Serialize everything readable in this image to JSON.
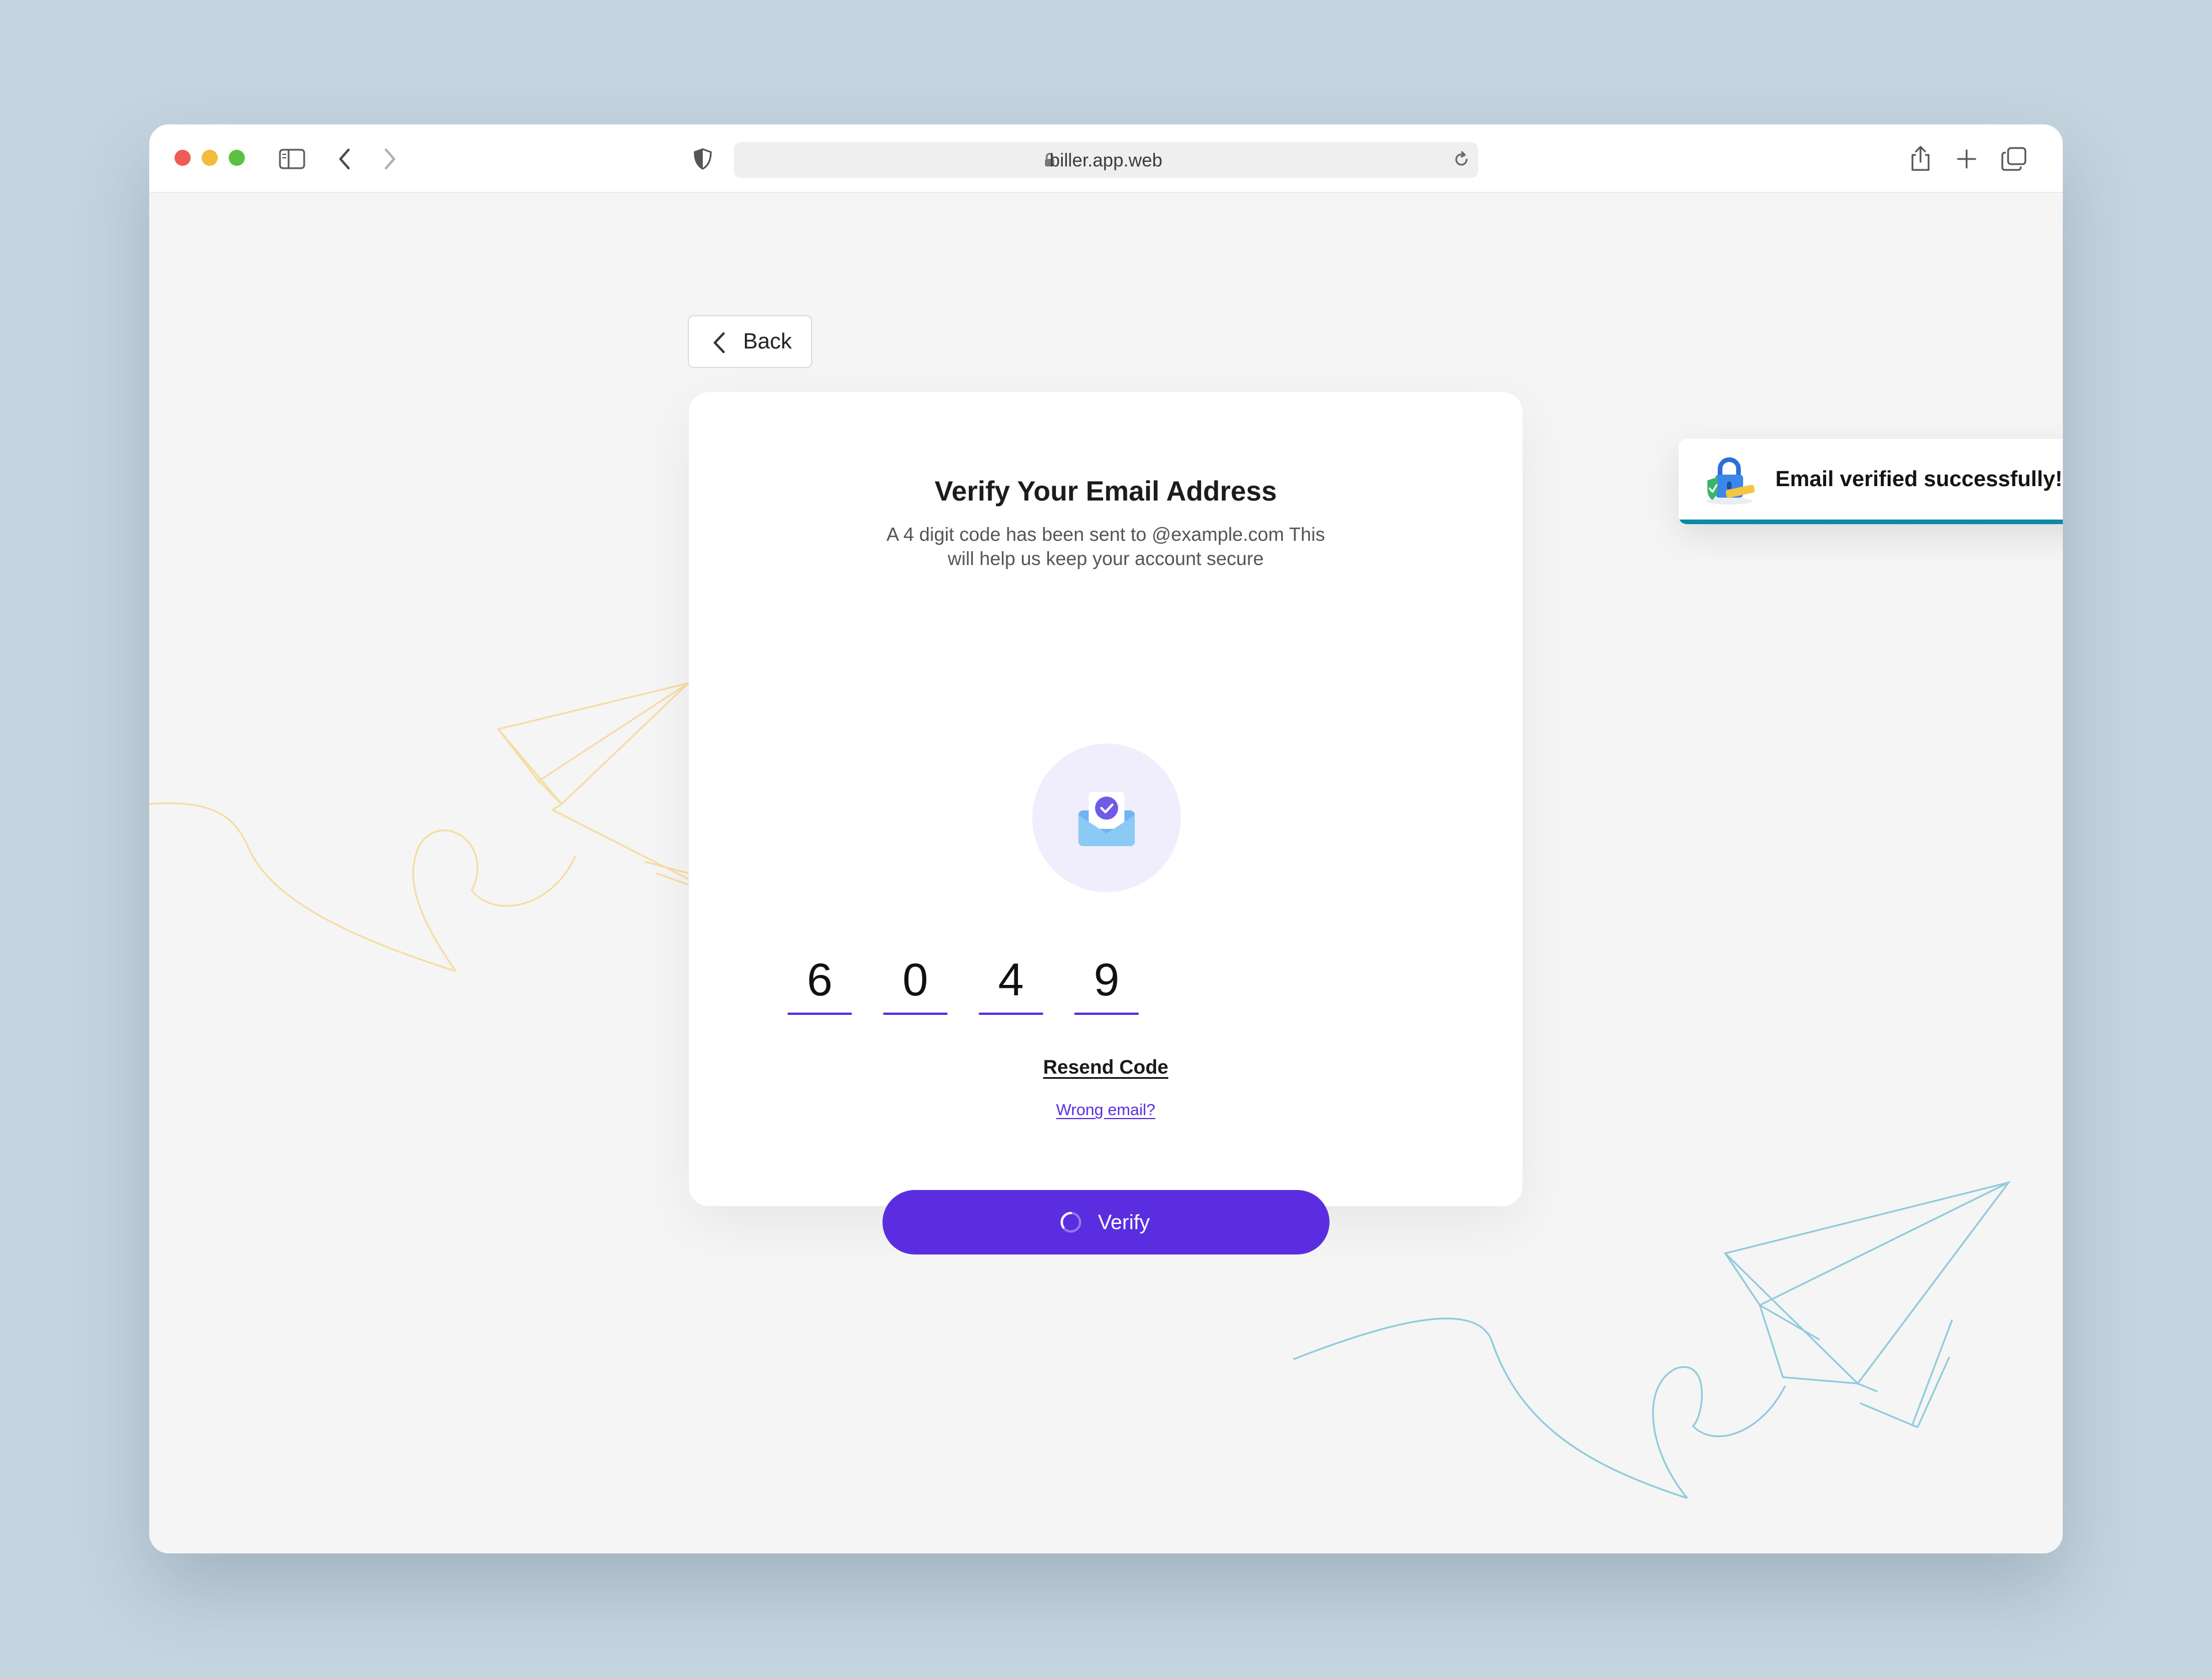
{
  "browser": {
    "url": "biller.app.web",
    "icons": {
      "close": "close-window-dot",
      "minimize": "minimize-window-dot",
      "maximize": "maximize-window-dot",
      "sidebar": "sidebar-toggle-icon",
      "back": "chevron-left-icon",
      "forward": "chevron-right-icon",
      "privacy": "privacy-shield-icon",
      "lock": "lock-icon",
      "reload": "reload-icon",
      "share": "share-icon",
      "new_tab": "plus-icon",
      "tabs": "tab-overview-icon"
    }
  },
  "page": {
    "back_label": "Back",
    "title": "Verify Your Email Address",
    "subtitle": "A 4 digit code has been sent to @example.com This will help us keep your account secure",
    "otp": [
      "6",
      "0",
      "4",
      "9"
    ],
    "resend_label": "Resend Code",
    "wrong_email_label": "Wrong email?",
    "verify_label": "Verify",
    "verify_loading": true
  },
  "toast": {
    "message": "Email verified successfully!",
    "icon": "padlock-shield-icon"
  },
  "colors": {
    "accent": "#5a2ee0",
    "toast_bar": "#0d8aa5",
    "background": "#c5d5df",
    "deco_yellow": "#f6dca3",
    "deco_blue": "#8fcbdc"
  }
}
